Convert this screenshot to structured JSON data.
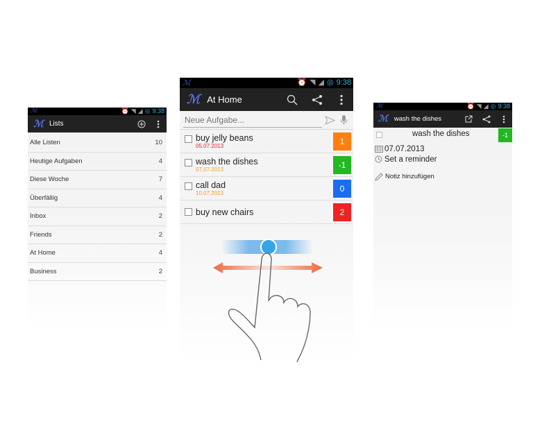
{
  "left_phone": {
    "status_time": "9:38",
    "app_title": "Lists",
    "lists": [
      {
        "name": "Alle Listen",
        "count": "10"
      },
      {
        "name": "Heutige Aufgaben",
        "count": "4"
      },
      {
        "name": "Diese Woche",
        "count": "7"
      },
      {
        "name": "Überfällig",
        "count": "4"
      },
      {
        "name": "Inbox",
        "count": "2"
      },
      {
        "name": "Friends",
        "count": "2"
      },
      {
        "name": "At Home",
        "count": "4"
      },
      {
        "name": "Business",
        "count": "2"
      }
    ]
  },
  "middle_phone": {
    "status_time": "9:38",
    "app_title": "At Home",
    "new_task_placeholder": "Neue Aufgabe...",
    "tasks": [
      {
        "title": "buy jelly beans",
        "date": "05.07.2013",
        "date_color": "#e02020",
        "priority": "1",
        "priority_color": "#ff7f0e"
      },
      {
        "title": "wash the dishes",
        "date": "07.07.2013",
        "date_color": "#f0a020",
        "priority": "-1",
        "priority_color": "#22b822"
      },
      {
        "title": "call dad",
        "date": "10.07.2013",
        "date_color": "#f0a020",
        "priority": "0",
        "priority_color": "#1a6df0"
      },
      {
        "title": "buy new chairs",
        "date": "",
        "date_color": "#f0a020",
        "priority": "2",
        "priority_color": "#ee2222"
      }
    ],
    "swipe_colors": {
      "bar": "#6fb3ea",
      "knob": "#37a4e8",
      "arrow": "#ee6a40"
    }
  },
  "right_phone": {
    "status_time": "9:38",
    "app_title": "wash the dishes",
    "task_title": "wash the dishes",
    "priority": "-1",
    "priority_color": "#22b822",
    "due_date": "07.07.2013",
    "reminder_label": "Set a reminder",
    "add_note_label": "Notiz hinzufügen"
  }
}
